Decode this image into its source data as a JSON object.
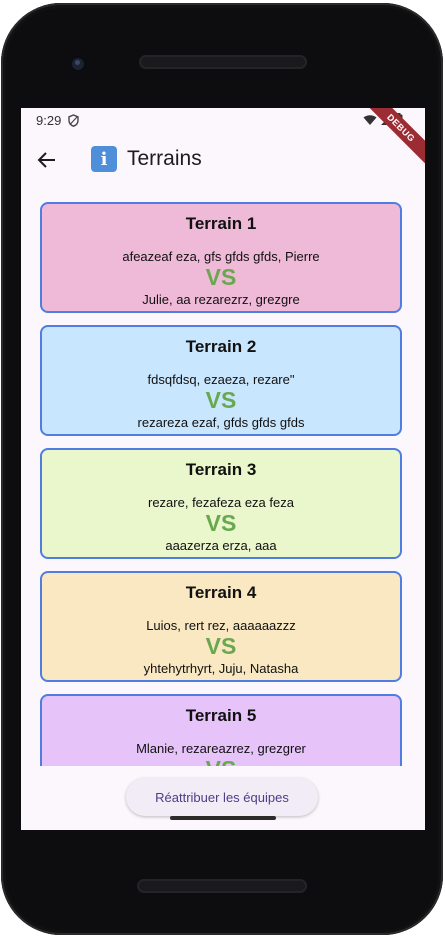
{
  "status": {
    "time": "9:29",
    "debug_label": "DEBUG"
  },
  "app_bar": {
    "title": "Terrains"
  },
  "terrains": [
    {
      "name": "Terrain 1",
      "team1": "afeazeaf eza, gfs gfds gfds, Pierre",
      "vs": "VS",
      "team2": "Julie, aa rezarezrz, grezgre",
      "color": "#efbad7"
    },
    {
      "name": "Terrain 2",
      "team1": "fdsqfdsq, ezaeza, rezare\"",
      "vs": "VS",
      "team2": "rezareza ezaf, gfds gfds gfds",
      "color": "#c8e6fd"
    },
    {
      "name": "Terrain 3",
      "team1": "rezare, fezafeza eza feza",
      "vs": "VS",
      "team2": "aaazerza erza, aaa",
      "color": "#eaf6cb"
    },
    {
      "name": "Terrain 4",
      "team1": "Luios, rert rez, aaaaaazzz",
      "vs": "VS",
      "team2": "yhtehytrhyrt, Juju, Natasha",
      "color": "#f9e8c2"
    },
    {
      "name": "Terrain 5",
      "team1": "Mlanie, rezareazrez, grezgrer",
      "vs": "VS",
      "team2": "",
      "color": "#e6c3f8"
    }
  ],
  "reassign_button": {
    "label": "Réattribuer les équipes"
  }
}
